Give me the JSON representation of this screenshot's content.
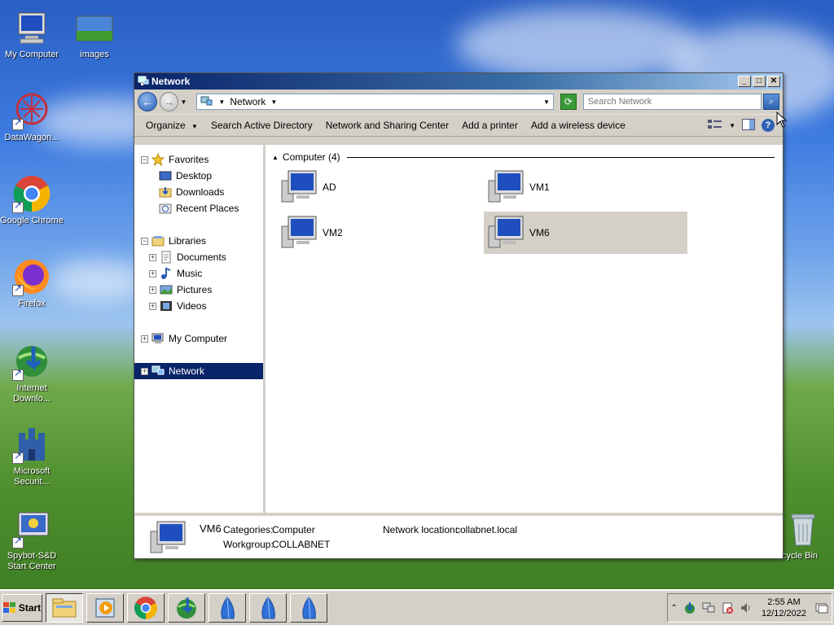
{
  "desktop": {
    "icons": [
      {
        "label": "My Computer"
      },
      {
        "label": "images"
      },
      {
        "label": "DataWagon..."
      },
      {
        "label": "Google Chrome"
      },
      {
        "label": "Firefox"
      },
      {
        "label": "Internet Downlo..."
      },
      {
        "label": "Microsoft Securit..."
      },
      {
        "label": "Spybot-S&D Start Center"
      },
      {
        "label": "cycle Bin"
      }
    ]
  },
  "window": {
    "title": "Network",
    "address": {
      "location": "Network"
    },
    "search": {
      "placeholder": "Search Network"
    },
    "toolbar": {
      "organize": "Organize",
      "search_ad": "Search Active Directory",
      "sharing_center": "Network and Sharing Center",
      "add_printer": "Add a printer",
      "add_wireless": "Add a wireless device"
    },
    "nav": {
      "favorites": "Favorites",
      "desktop": "Desktop",
      "downloads": "Downloads",
      "recent": "Recent Places",
      "libraries": "Libraries",
      "documents": "Documents",
      "music": "Music",
      "pictures": "Pictures",
      "videos": "Videos",
      "my_computer": "My Computer",
      "network": "Network"
    },
    "group_header": "Computer (4)",
    "computers": [
      {
        "name": "AD"
      },
      {
        "name": "VM1"
      },
      {
        "name": "VM2"
      },
      {
        "name": "VM6",
        "selected": true
      }
    ],
    "details": {
      "name": "VM6",
      "categories_label": "Categories:",
      "categories_value": "Computer",
      "workgroup_label": "Workgroup:",
      "workgroup_value": "COLLABNET",
      "location_label": "Network location:",
      "location_value": "collabnet.local"
    }
  },
  "taskbar": {
    "start_label": "Start",
    "time": "2:55 AM",
    "date": "12/12/2022"
  },
  "colors": {
    "titlebar_start": "#0a246a",
    "selection": "#0a246a",
    "chrome": "#d4d0c8"
  }
}
